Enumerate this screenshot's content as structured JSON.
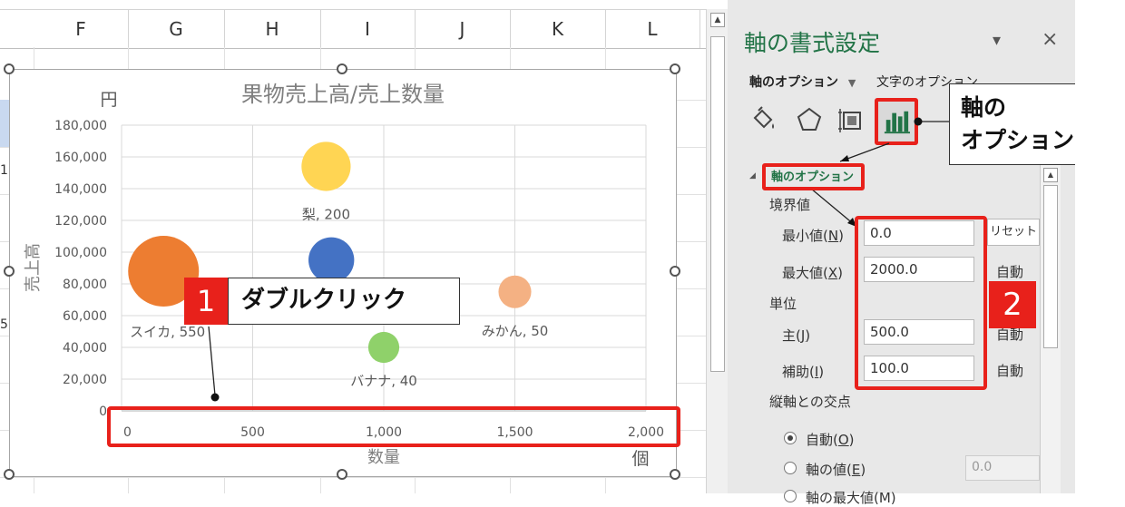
{
  "sheet": {
    "columns": [
      "F",
      "G",
      "H",
      "I",
      "J",
      "K",
      "L"
    ],
    "left_cells": [
      "1",
      "5"
    ]
  },
  "chart_data": {
    "type": "scatter",
    "title": "果物売上高/売上数量",
    "xlabel": "数量",
    "ylabel": "売上高",
    "x_unit": "個",
    "y_unit": "円",
    "xlim": [
      0,
      2000
    ],
    "ylim": [
      0,
      180000
    ],
    "x_ticks": [
      "0",
      "500",
      "1,000",
      "1,500",
      "2,000"
    ],
    "y_ticks": [
      "0",
      "20,000",
      "40,000",
      "60,000",
      "80,000",
      "100,000",
      "120,000",
      "140,000",
      "160,000",
      "180,000"
    ],
    "grid": true,
    "points": [
      {
        "label": "スイカ, 550",
        "x": 160,
        "y": 88000,
        "size": 550,
        "color": "#ed7d31"
      },
      {
        "label": "梨, 200",
        "x": 780,
        "y": 154000,
        "size": 200,
        "color": "#ffd553"
      },
      {
        "label": "",
        "x": 800,
        "y": 95000,
        "size": 160,
        "color": "#4472c4"
      },
      {
        "label": "バナナ, 40",
        "x": 1000,
        "y": 40000,
        "size": 40,
        "color": "#8fd16a"
      },
      {
        "label": "みかん, 50",
        "x": 1500,
        "y": 75000,
        "size": 50,
        "color": "#f4b183"
      }
    ]
  },
  "annotations": {
    "step1_number": "1",
    "step1_text": "ダブルクリック",
    "step2_number": "2",
    "axis_option_callout_line1": "軸の",
    "axis_option_callout_line2": "オプション"
  },
  "pane": {
    "title": "軸の書式設定",
    "dropdown_glyph": "▾",
    "close_glyph": "×",
    "tab_axis_options": "軸のオプション",
    "tab_arrow": "▼",
    "tab_text_options": "文字のオプション",
    "section_title": "軸のオプション",
    "bounds_label": "境界値",
    "min_label": "最小値(",
    "min_key": "N",
    "max_label": "最大値(",
    "max_key": "X",
    "close_paren": ")",
    "min_value": "0.0",
    "max_value": "2000.0",
    "reset_label": "リセット",
    "auto_label": "自動",
    "units_label": "単位",
    "major_label": "主(",
    "major_key": "J",
    "minor_label": "補助(",
    "minor_key": "I",
    "major_value": "500.0",
    "minor_value": "100.0",
    "cross_label": "縦軸との交点",
    "radio_auto": "自動(",
    "radio_auto_key": "O",
    "radio_value": "軸の値(",
    "radio_value_key": "E",
    "axis_value": "0.0",
    "radio_max": "軸の最大値(M)"
  },
  "colors": {
    "accent_red": "#e8211b",
    "excel_green": "#217346"
  }
}
